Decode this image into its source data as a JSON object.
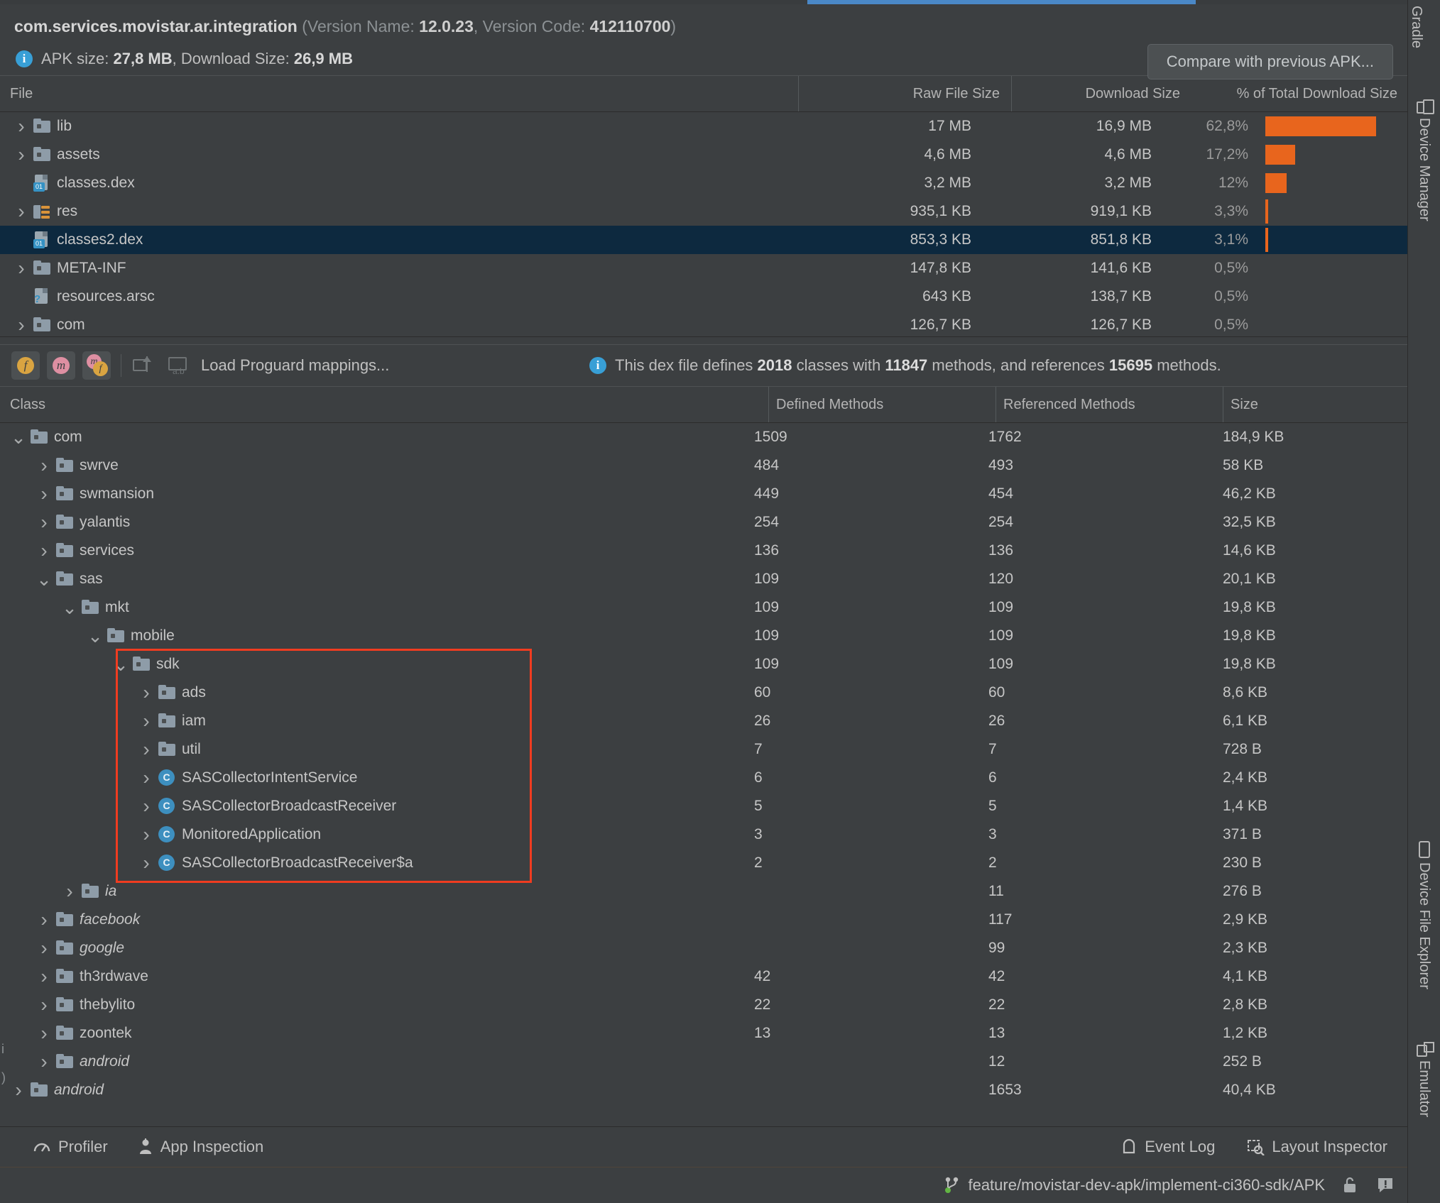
{
  "header": {
    "package": "com.services.movistar.ar.integration",
    "version_prefix": "(Version Name: ",
    "version_name": "12.0.23",
    "version_code_label": ", Version Code: ",
    "version_code": "412110700",
    "version_suffix": ")",
    "apk_size_label": "APK size: ",
    "apk_size": "27,8 MB",
    "download_size_label": ", Download Size: ",
    "download_size": "26,9 MB",
    "compare_button": "Compare with previous APK..."
  },
  "file_table": {
    "columns": [
      "File",
      "Raw File Size",
      "Download Size",
      "% of Total Download Size"
    ],
    "rows": [
      {
        "name": "lib",
        "icon": "folder",
        "chevron": ">",
        "indent": 0,
        "raw": "17 MB",
        "download": "16,9 MB",
        "pct": "62,8%",
        "bar": 78,
        "selected": false
      },
      {
        "name": "assets",
        "icon": "folder",
        "chevron": ">",
        "indent": 0,
        "raw": "4,6 MB",
        "download": "4,6 MB",
        "pct": "17,2%",
        "bar": 21,
        "selected": false
      },
      {
        "name": "classes.dex",
        "icon": "dex",
        "chevron": "",
        "indent": 0,
        "raw": "3,2 MB",
        "download": "3,2 MB",
        "pct": "12%",
        "bar": 15,
        "selected": false
      },
      {
        "name": "res",
        "icon": "res",
        "chevron": ">",
        "indent": 0,
        "raw": "935,1 KB",
        "download": "919,1 KB",
        "pct": "3,3%",
        "bar": 4,
        "selected": false
      },
      {
        "name": "classes2.dex",
        "icon": "dex",
        "chevron": "",
        "indent": 0,
        "raw": "853,3 KB",
        "download": "851,8 KB",
        "pct": "3,1%",
        "bar": 4,
        "selected": true
      },
      {
        "name": "META-INF",
        "icon": "folder",
        "chevron": ">",
        "indent": 0,
        "raw": "147,8 KB",
        "download": "141,6 KB",
        "pct": "0,5%",
        "bar": 0,
        "selected": false
      },
      {
        "name": "resources.arsc",
        "icon": "arsc",
        "chevron": "",
        "indent": 0,
        "raw": "643 KB",
        "download": "138,7 KB",
        "pct": "0,5%",
        "bar": 0,
        "selected": false
      },
      {
        "name": "com",
        "icon": "folder",
        "chevron": ">",
        "indent": 0,
        "raw": "126,7 KB",
        "download": "126,7 KB",
        "pct": "0,5%",
        "bar": 0,
        "selected": false
      }
    ]
  },
  "dex_toolbar": {
    "toggle_fields": "f",
    "toggle_methods": "m",
    "toggle_both_m": "m",
    "toggle_both_f": "f",
    "load_proguard": "Load Proguard mappings...",
    "info_prefix": "This dex file defines ",
    "classes_count": "2018",
    "info_mid1": " classes with ",
    "methods_count": "11847",
    "info_mid2": " methods, and references ",
    "referenced_count": "15695",
    "info_suffix": " methods."
  },
  "class_table": {
    "columns": [
      "Class",
      "Defined Methods",
      "Referenced Methods",
      "Size"
    ],
    "rows": [
      {
        "name": "com",
        "icon": "folder",
        "chevron": "v",
        "indent": 0,
        "italic": false,
        "defined": "1509",
        "referenced": "1762",
        "size": "184,9 KB"
      },
      {
        "name": "swrve",
        "icon": "folder",
        "chevron": ">",
        "indent": 1,
        "italic": false,
        "defined": "484",
        "referenced": "493",
        "size": "58 KB"
      },
      {
        "name": "swmansion",
        "icon": "folder",
        "chevron": ">",
        "indent": 1,
        "italic": false,
        "defined": "449",
        "referenced": "454",
        "size": "46,2 KB"
      },
      {
        "name": "yalantis",
        "icon": "folder",
        "chevron": ">",
        "indent": 1,
        "italic": false,
        "defined": "254",
        "referenced": "254",
        "size": "32,5 KB"
      },
      {
        "name": "services",
        "icon": "folder",
        "chevron": ">",
        "indent": 1,
        "italic": false,
        "defined": "136",
        "referenced": "136",
        "size": "14,6 KB"
      },
      {
        "name": "sas",
        "icon": "folder",
        "chevron": "v",
        "indent": 1,
        "italic": false,
        "defined": "109",
        "referenced": "120",
        "size": "20,1 KB"
      },
      {
        "name": "mkt",
        "icon": "folder",
        "chevron": "v",
        "indent": 2,
        "italic": false,
        "defined": "109",
        "referenced": "109",
        "size": "19,8 KB"
      },
      {
        "name": "mobile",
        "icon": "folder",
        "chevron": "v",
        "indent": 3,
        "italic": false,
        "defined": "109",
        "referenced": "109",
        "size": "19,8 KB"
      },
      {
        "name": "sdk",
        "icon": "folder",
        "chevron": "v",
        "indent": 4,
        "italic": false,
        "defined": "109",
        "referenced": "109",
        "size": "19,8 KB"
      },
      {
        "name": "ads",
        "icon": "folder",
        "chevron": ">",
        "indent": 5,
        "italic": false,
        "defined": "60",
        "referenced": "60",
        "size": "8,6 KB"
      },
      {
        "name": "iam",
        "icon": "folder",
        "chevron": ">",
        "indent": 5,
        "italic": false,
        "defined": "26",
        "referenced": "26",
        "size": "6,1 KB"
      },
      {
        "name": "util",
        "icon": "folder",
        "chevron": ">",
        "indent": 5,
        "italic": false,
        "defined": "7",
        "referenced": "7",
        "size": "728 B"
      },
      {
        "name": "SASCollectorIntentService",
        "icon": "class",
        "chevron": ">",
        "indent": 5,
        "italic": false,
        "defined": "6",
        "referenced": "6",
        "size": "2,4 KB"
      },
      {
        "name": "SASCollectorBroadcastReceiver",
        "icon": "class",
        "chevron": ">",
        "indent": 5,
        "italic": false,
        "defined": "5",
        "referenced": "5",
        "size": "1,4 KB"
      },
      {
        "name": "MonitoredApplication",
        "icon": "class",
        "chevron": ">",
        "indent": 5,
        "italic": false,
        "defined": "3",
        "referenced": "3",
        "size": "371 B"
      },
      {
        "name": "SASCollectorBroadcastReceiver$a",
        "icon": "class",
        "chevron": ">",
        "indent": 5,
        "italic": false,
        "defined": "2",
        "referenced": "2",
        "size": "230 B"
      },
      {
        "name": "ia",
        "icon": "folder",
        "chevron": ">",
        "indent": 2,
        "italic": true,
        "defined": "",
        "referenced": "11",
        "size": "276 B"
      },
      {
        "name": "facebook",
        "icon": "folder",
        "chevron": ">",
        "indent": 1,
        "italic": true,
        "defined": "",
        "referenced": "117",
        "size": "2,9 KB"
      },
      {
        "name": "google",
        "icon": "folder",
        "chevron": ">",
        "indent": 1,
        "italic": true,
        "defined": "",
        "referenced": "99",
        "size": "2,3 KB"
      },
      {
        "name": "th3rdwave",
        "icon": "folder",
        "chevron": ">",
        "indent": 1,
        "italic": false,
        "defined": "42",
        "referenced": "42",
        "size": "4,1 KB"
      },
      {
        "name": "thebylito",
        "icon": "folder",
        "chevron": ">",
        "indent": 1,
        "italic": false,
        "defined": "22",
        "referenced": "22",
        "size": "2,8 KB"
      },
      {
        "name": "zoontek",
        "icon": "folder",
        "chevron": ">",
        "indent": 1,
        "italic": false,
        "defined": "13",
        "referenced": "13",
        "size": "1,2 KB"
      },
      {
        "name": "android",
        "icon": "folder",
        "chevron": ">",
        "indent": 1,
        "italic": true,
        "defined": "",
        "referenced": "12",
        "size": "252 B"
      },
      {
        "name": "android",
        "icon": "folder",
        "chevron": ">",
        "indent": 0,
        "italic": true,
        "defined": "",
        "referenced": "1653",
        "size": "40,4 KB"
      }
    ]
  },
  "bottom_tools": {
    "profiler": "Profiler",
    "app_inspection": "App Inspection",
    "event_log": "Event Log",
    "layout_inspector": "Layout Inspector"
  },
  "status_bar": {
    "branch": "feature/movistar-dev-apk/implement-ci360-sdk/APK"
  },
  "right_tabs": [
    {
      "label": "Gradle",
      "icon": "none"
    },
    {
      "label": "Device Manager",
      "icon": "device"
    },
    {
      "label": "Device File Explorer",
      "icon": "phone"
    },
    {
      "label": "Emulator",
      "icon": "emulator"
    }
  ],
  "colors": {
    "accent_bar": "#E8651D",
    "selection": "#0D293F",
    "highlight_box": "#F03C20",
    "active_tab": "#4A88C7",
    "info_blue": "#389FD6"
  }
}
